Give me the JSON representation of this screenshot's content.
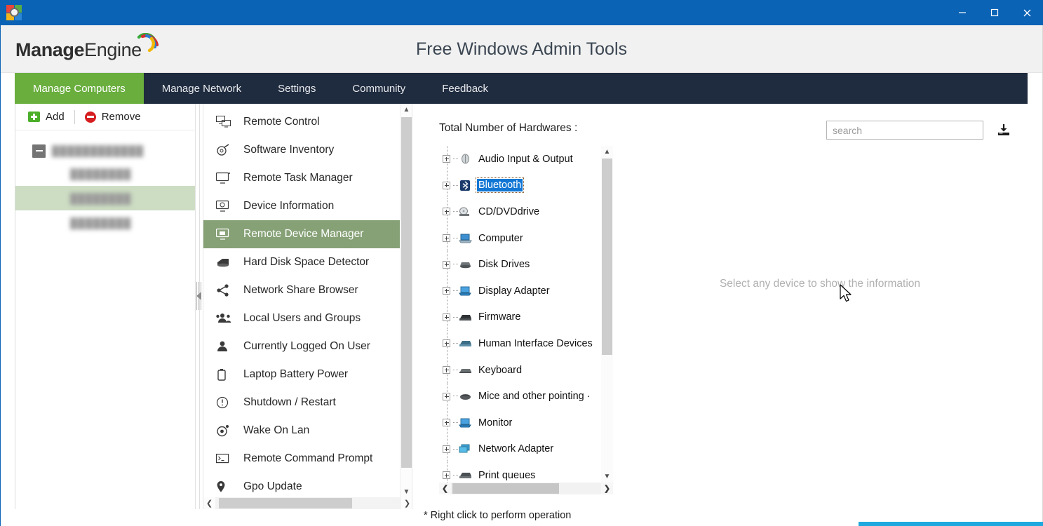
{
  "window": {
    "app_icon": "windows-gear-icon",
    "minimize_label": "minimize-icon",
    "maximize_label": "maximize-icon",
    "close_label": "close-icon",
    "titlebar_color": "#0a63b5"
  },
  "header": {
    "logo_part1": "Manage",
    "logo_part2": "Engine",
    "title": "Free Windows Admin Tools"
  },
  "tabs": [
    {
      "label": "Manage Computers",
      "active": true
    },
    {
      "label": "Manage Network",
      "active": false
    },
    {
      "label": "Settings",
      "active": false
    },
    {
      "label": "Community",
      "active": false
    },
    {
      "label": "Feedback",
      "active": false
    }
  ],
  "left_panel": {
    "toolbar": {
      "add_label": "Add",
      "remove_label": "Remove"
    },
    "tree": {
      "root": {
        "label": "████████████",
        "expanded": true
      },
      "children": [
        {
          "label": "████████",
          "selected": false
        },
        {
          "label": "████████",
          "selected": true
        },
        {
          "label": "████████",
          "selected": false
        }
      ]
    }
  },
  "menu_panel": {
    "items": [
      {
        "label": "Remote Control",
        "icon": "remote-control-icon",
        "active": false
      },
      {
        "label": "Software Inventory",
        "icon": "software-inventory-icon",
        "active": false
      },
      {
        "label": "Remote Task Manager",
        "icon": "monitor-icon",
        "active": false
      },
      {
        "label": "Device Information",
        "icon": "device-info-icon",
        "active": false
      },
      {
        "label": "Remote Device Manager",
        "icon": "device-manager-icon",
        "active": true
      },
      {
        "label": "Hard Disk Space Detector",
        "icon": "hard-disk-icon",
        "active": false
      },
      {
        "label": "Network Share Browser",
        "icon": "share-icon",
        "active": false
      },
      {
        "label": "Local Users and Groups",
        "icon": "users-group-icon",
        "active": false
      },
      {
        "label": "Currently Logged On User",
        "icon": "user-icon",
        "active": false
      },
      {
        "label": "Laptop Battery Power",
        "icon": "battery-icon",
        "active": false
      },
      {
        "label": "Shutdown / Restart",
        "icon": "power-icon",
        "active": false
      },
      {
        "label": "Wake On Lan",
        "icon": "wake-on-lan-icon",
        "active": false
      },
      {
        "label": "Remote Command Prompt",
        "icon": "command-prompt-icon",
        "active": false
      },
      {
        "label": "Gpo Update",
        "icon": "location-pin-icon",
        "active": false
      }
    ]
  },
  "right_panel": {
    "title": "Total Number of Hardwares :",
    "search": {
      "value": "",
      "placeholder": "search"
    },
    "export_icon": "download-export-icon",
    "empty_message": "Select any device to show the information",
    "footer_note": "* Right click to perform operation",
    "device_tree": [
      {
        "label": "Audio Input & Output",
        "icon": "audio-device-icon",
        "selected": false
      },
      {
        "label": "Bluetooth",
        "icon": "bluetooth-icon",
        "selected": true
      },
      {
        "label": "CD/DVDdrive",
        "icon": "cd-dvd-drive-icon",
        "selected": false
      },
      {
        "label": "Computer",
        "icon": "computer-icon",
        "selected": false
      },
      {
        "label": "Disk Drives",
        "icon": "disk-drive-icon",
        "selected": false
      },
      {
        "label": "Display Adapter",
        "icon": "display-adapter-icon",
        "selected": false
      },
      {
        "label": "Firmware",
        "icon": "firmware-icon",
        "selected": false
      },
      {
        "label": "Human Interface Devices",
        "icon": "hid-icon",
        "selected": false
      },
      {
        "label": "Keyboard",
        "icon": "keyboard-icon",
        "selected": false
      },
      {
        "label": "Mice and other pointing ·",
        "icon": "mouse-icon",
        "selected": false
      },
      {
        "label": "Monitor",
        "icon": "monitor-device-icon",
        "selected": false
      },
      {
        "label": "Network Adapter",
        "icon": "network-adapter-icon",
        "selected": false
      },
      {
        "label": "Print queues",
        "icon": "printer-icon",
        "selected": false
      }
    ]
  }
}
